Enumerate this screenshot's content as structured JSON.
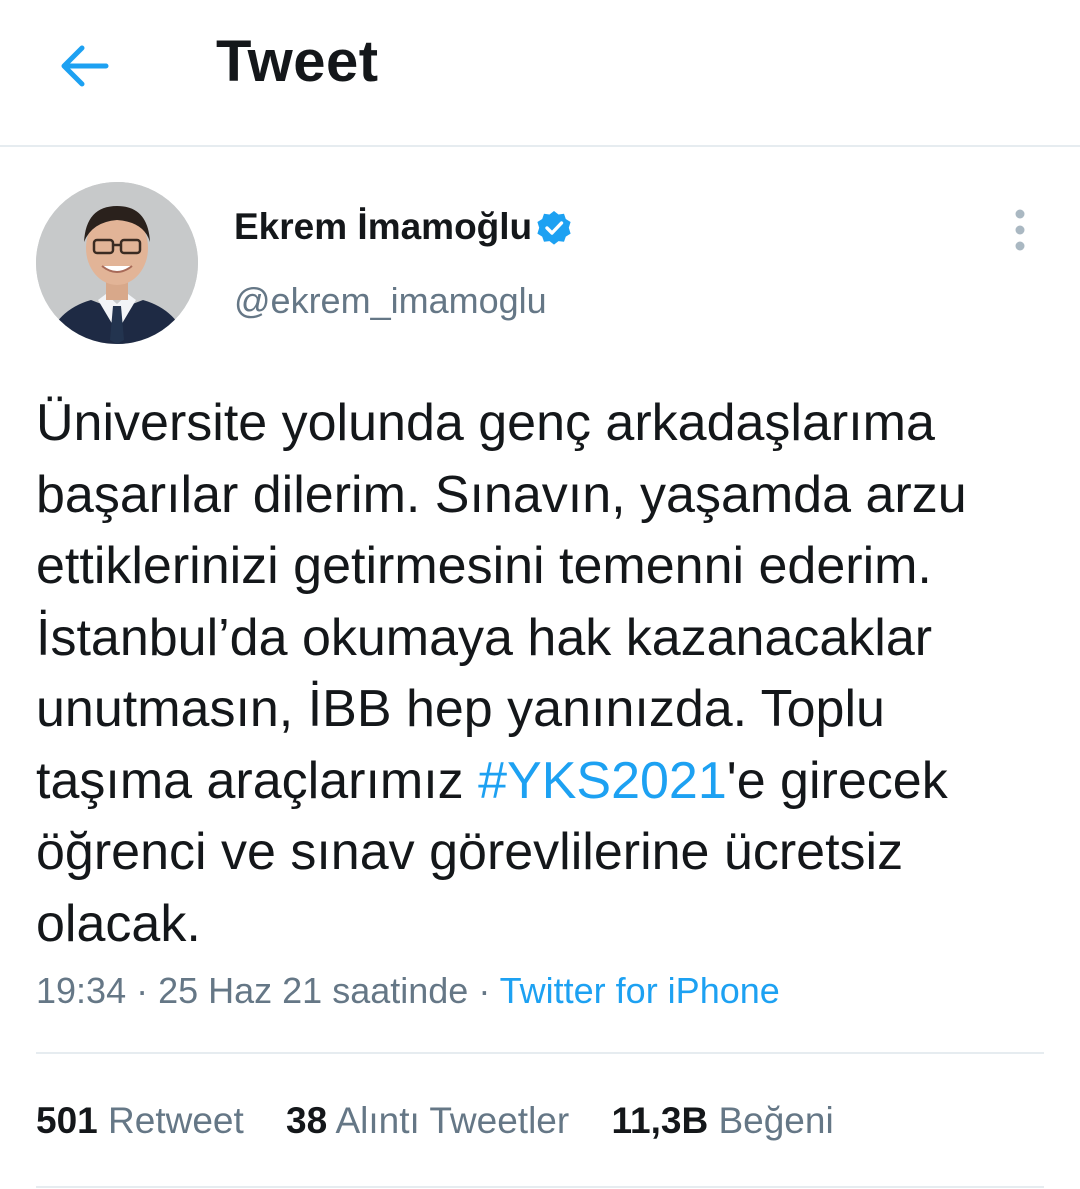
{
  "header": {
    "title": "Tweet",
    "back_icon": "arrow-left-icon",
    "accent": "#1da1f2"
  },
  "author": {
    "display_name": "Ekrem İmamoğlu",
    "handle": "@ekrem_imamoglu",
    "verified": true,
    "verified_icon": "verified-badge-icon"
  },
  "tweet": {
    "text_before": "Üniversite yolunda genç arkadaşlarıma başarılar dilerim. Sınavın, yaşamda arzu ettiklerinizi getirmesini temenni ederim. İstanbul’da okumaya hak kazanacaklar unutmasın, İBB hep yanınızda. Toplu taşıma araçlarımız ",
    "hashtag": "#YKS2021",
    "text_after": "'e girecek öğrenci ve sınav görevlilerine ücretsiz olacak."
  },
  "meta": {
    "time": "19:34",
    "separator": " · ",
    "date": "25 Haz 21 saatinde",
    "source": "Twitter for iPhone"
  },
  "stats": [
    {
      "count": "501",
      "label": "Retweet"
    },
    {
      "count": "38",
      "label": "Alıntı Tweetler"
    },
    {
      "count": "11,3B",
      "label": "Beğeni"
    }
  ],
  "colors": {
    "text": "#14171a",
    "secondary": "#657786",
    "link": "#1da1f2",
    "divider": "#e6ecf0"
  }
}
